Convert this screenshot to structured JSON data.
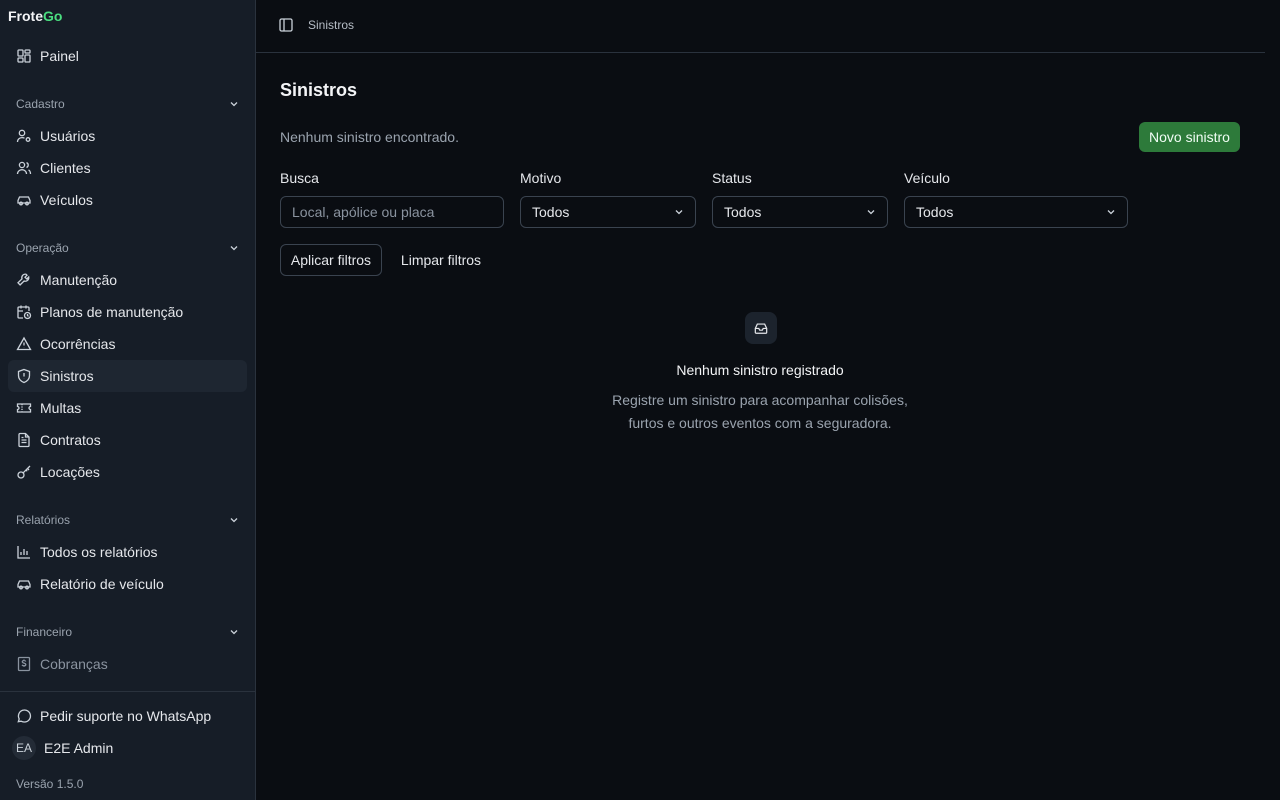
{
  "brand": {
    "part1": "Frote",
    "part2": "Go"
  },
  "sidebar": {
    "painel": "Painel",
    "groups": {
      "cadastro": "Cadastro",
      "operacao": "Operação",
      "relatorios": "Relatórios",
      "financeiro": "Financeiro"
    },
    "cadastro": [
      "Usuários",
      "Clientes",
      "Veículos"
    ],
    "operacao": [
      "Manutenção",
      "Planos de manutenção",
      "Ocorrências",
      "Sinistros",
      "Multas",
      "Contratos",
      "Locações"
    ],
    "relatorios": [
      "Todos os relatórios",
      "Relatório de veículo"
    ],
    "financeiro": [
      "Cobranças"
    ],
    "support": "Pedir suporte no WhatsApp",
    "user": {
      "initials": "EA",
      "name": "E2E Admin"
    },
    "version": "Versão 1.5.0"
  },
  "header": {
    "breadcrumb": "Sinistros"
  },
  "main": {
    "title": "Sinistros",
    "subtitle": "Nenhum sinistro encontrado.",
    "new_button": "Novo sinistro",
    "filters": {
      "busca_label": "Busca",
      "busca_placeholder": "Local, apólice ou placa",
      "motivo_label": "Motivo",
      "motivo_value": "Todos",
      "status_label": "Status",
      "status_value": "Todos",
      "veiculo_label": "Veículo",
      "veiculo_value": "Todos",
      "apply": "Aplicar filtros",
      "clear": "Limpar filtros"
    },
    "empty": {
      "title": "Nenhum sinistro registrado",
      "desc_line1": "Registre um sinistro para acompanhar colisões,",
      "desc_line2": "furtos e outros eventos com a seguradora."
    }
  },
  "colors": {
    "accent": "#2d7a3a",
    "brand_go": "#4ade80",
    "sidebar_bg": "#161d27",
    "page_bg": "#0a0d12"
  },
  "icons": {
    "painel": "dashboard-icon",
    "usuarios": "user-cog-icon",
    "clientes": "users-icon",
    "veiculos": "car-icon",
    "manutencao": "wrench-icon",
    "planos": "calendar-clock-icon",
    "ocorrencias": "alert-triangle-icon",
    "sinistros": "shield-alert-icon",
    "multas": "ticket-icon",
    "contratos": "file-text-icon",
    "locacoes": "key-icon",
    "todos_relatorios": "bar-chart-icon",
    "relatorio_veiculo": "car-icon",
    "cobrancas": "dollar-receipt-icon",
    "suporte": "message-circle-icon",
    "empty": "inbox-icon"
  }
}
